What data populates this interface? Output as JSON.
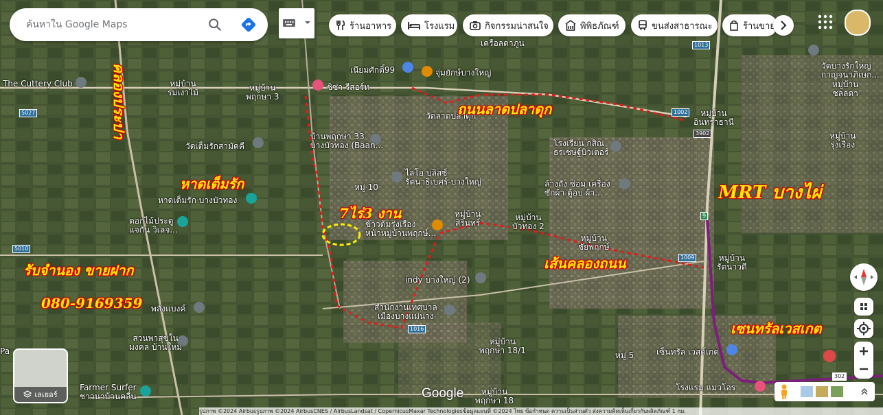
{
  "search": {
    "placeholder": "ค้นหาใน Google Maps"
  },
  "chips": [
    {
      "label": "ร้านอาหาร",
      "icon": "fork-knife-icon"
    },
    {
      "label": "โรงแรม",
      "icon": "bed-icon"
    },
    {
      "label": "กิจกรรมน่าสนใจ",
      "icon": "camera-icon"
    },
    {
      "label": "พิพิธภัณฑ์",
      "icon": "museum-icon"
    },
    {
      "label": "ขนส่งสาธารณะ",
      "icon": "train-icon"
    },
    {
      "label": "ร้านขาย",
      "icon": "store-icon"
    }
  ],
  "annotations": {
    "canal_vertical": "คลองประปา",
    "had_tem_rak": "หาดเต็มรัก",
    "plot_size": "7ไร่3 งาน",
    "lat_pla_duk_road": "ถนนลาดปลาดุก",
    "mrt": "MRT บางไผ่",
    "khlong_thanon": "เส้นคลองถนน",
    "central_west_gate": "เซนทรัลเวสเกต",
    "mortgage": "รับจำนอง ขายฝาก",
    "phone": "080-9169359"
  },
  "places": {
    "cuttery": "The Cuttery Club",
    "mooban_rom": "หมู่บ้าน\nร่มเงาไม้",
    "mooban_pruksa3": "หมู่บ้าน\nพฤกษา 3",
    "sisa": "ชิซ่า รีสอร์ท",
    "nianisak": "เนียมศักดิ์99",
    "jumyakbang": "จุ่มยักษ์บางใหญ่",
    "wat_lat": "วัดลาดปลาดุก",
    "wat_tem": "วัดเต็มรักสามัคคี",
    "ban_pruksa33": "บ้านพฤกษา 33\nบางบัวทอง (Baan...",
    "lailo": "ไลโอ บลิสซ์\nรัตนาธิเบศร์-บางใหญ่",
    "moo10": "หมู่ 10",
    "had_tem_rak_bua": "หาดเต็มรัก บางบัวทอง",
    "dokmai": "ดอกไม้ประตู\nแจกัน วิเลจ...",
    "khao_tom": "ข้าวต้มรุ่งเรือง\nหน้าหมู่บ้านพฤกษ์...",
    "mooban_sirin": "หมู่บ้าน\nสิรินทร์",
    "mooban_bua2": "หมู่บ้าน\nบัวทอง 2",
    "indy": "indy บางใหญ่ (2)",
    "tessaban": "สำนักงานเทศบาล\nเมืองบางแม่นาง",
    "pleng": "พลังแบงค์",
    "suan": "สวนพาสุขใน\nมงคล บ้านใหม่",
    "farmer": "Farmer Surfer\nชาวนาบ้านคลื่น",
    "pruksa181": "หมู่บ้าน\nพฤกษา 18/1",
    "pruksa18": "หมู่บ้าน\nพฤกษา 18",
    "mooban_chai": "หมู่บ้าน\nชัยพฤกษ์",
    "mooban_ratana": "หมู่บ้าน\nรัตนาวดี",
    "school": "โรงเรียน กสิณ\nธรเชษฐ์บิวเตอร์",
    "carwash": "ล้างถัง ซ่อม เครื่อง\nซักผ้า ตู้อบ ผ้า...",
    "central": "เซ็นทรัล เวสต์เกต",
    "hotel": "โรงแรม แมวโอร",
    "moo5": "หมู่ 5",
    "wat_bang_rak": "วัดบางรักใหญ่\nกาญจนาภิเษก...",
    "mooban_chon": "หมู่บ้าน\nชลลดา",
    "mooban_inthara": "หมู่บ้าน\nอินทราธานี",
    "mooban_rung": "หมู่บ้าน\nรุ่งเรือง",
    "krisda": "เครือลดาภูน",
    "moo_pa": "Pa"
  },
  "road_shields": [
    "5027",
    "5010",
    "1009",
    "1016",
    "1013",
    "1002",
    "3902",
    "302",
    "9"
  ],
  "controls": {
    "layers_label": "เลเยอร์",
    "google_logo": "Google",
    "credits": "รูปภาพ ©2024 Airbusรูปภาพ ©2024 AirbusCNES / AirbusLandsat / CopernicusMaxar Technologiesข้อมูลแผนที่ ©2024   ไทย   ข้อกำหนด   ความเป็นส่วนตัว   ส่งความคิดเห็นเกี่ยวกับผลิตภัณฑ์   1 กม."
  },
  "colors": {
    "annotation_text": "#ffe600",
    "annotation_stroke": "#d10000",
    "dotted_route": "#e41b1b",
    "mrt_line": "#7b1f7a",
    "plot_circle": "#ffee00"
  }
}
